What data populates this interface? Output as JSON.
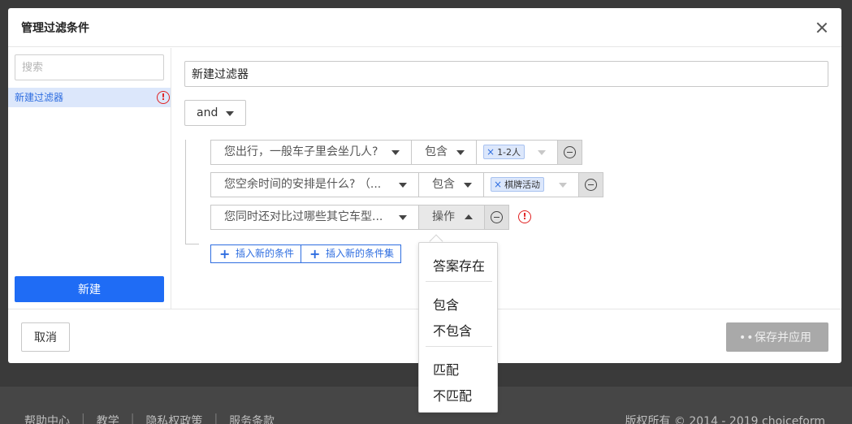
{
  "modal": {
    "title": "管理过滤条件",
    "search_placeholder": "搜索",
    "filter_items": [
      "新建过滤器"
    ],
    "new_button": "新建",
    "filter_name_value": "新建过滤器",
    "logic": "and",
    "conditions": [
      {
        "question": "您出行，一般车子里会坐几人?",
        "operator": "包含",
        "values": [
          "1-2人"
        ]
      },
      {
        "question": "您空余时间的安排是什么? （...",
        "operator": "包含",
        "values": [
          "棋牌活动"
        ]
      },
      {
        "question": "您同时还对比过哪些其它车型...",
        "operator": "操作",
        "values": []
      }
    ],
    "insert_condition": "插入新的条件",
    "insert_condition_set": "插入新的条件集",
    "cancel_button": "取消",
    "save_button": "保存并应用"
  },
  "operator_menu": {
    "group1": [
      "答案存在"
    ],
    "group2": [
      "包含",
      "不包含"
    ],
    "group3": [
      "匹配",
      "不匹配"
    ]
  },
  "footer": {
    "links": [
      "帮助中心",
      "教学",
      "隐私权政策",
      "服务条款"
    ],
    "copyright": "版权所有 © 2014 - 2019 choiceform"
  },
  "colors": {
    "primary": "#1f6cf5",
    "error": "#e02020",
    "disabled": "#a9a9a9"
  }
}
